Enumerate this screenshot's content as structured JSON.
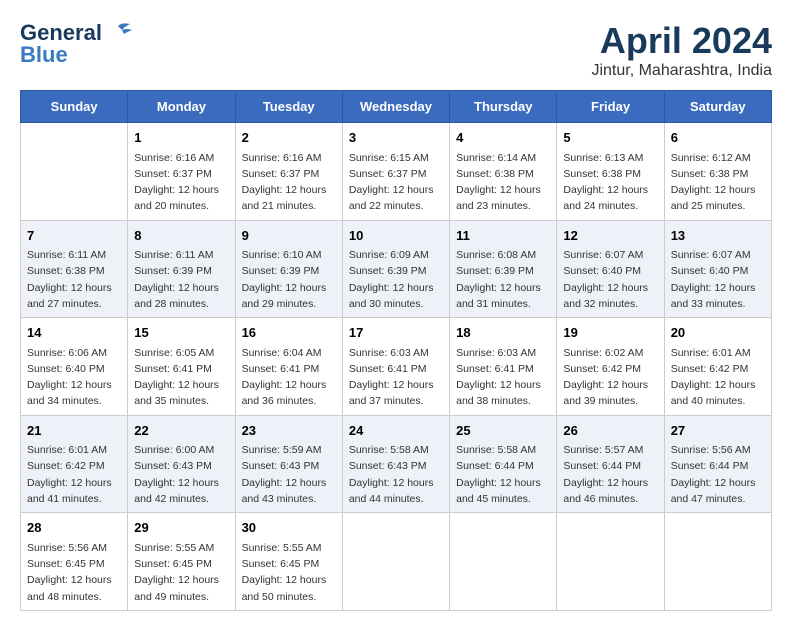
{
  "logo": {
    "line1": "General",
    "line2": "Blue"
  },
  "title": "April 2024",
  "subtitle": "Jintur, Maharashtra, India",
  "days_header": [
    "Sunday",
    "Monday",
    "Tuesday",
    "Wednesday",
    "Thursday",
    "Friday",
    "Saturday"
  ],
  "weeks": [
    [
      {
        "num": "",
        "detail": ""
      },
      {
        "num": "1",
        "detail": "Sunrise: 6:16 AM\nSunset: 6:37 PM\nDaylight: 12 hours\nand 20 minutes."
      },
      {
        "num": "2",
        "detail": "Sunrise: 6:16 AM\nSunset: 6:37 PM\nDaylight: 12 hours\nand 21 minutes."
      },
      {
        "num": "3",
        "detail": "Sunrise: 6:15 AM\nSunset: 6:37 PM\nDaylight: 12 hours\nand 22 minutes."
      },
      {
        "num": "4",
        "detail": "Sunrise: 6:14 AM\nSunset: 6:38 PM\nDaylight: 12 hours\nand 23 minutes."
      },
      {
        "num": "5",
        "detail": "Sunrise: 6:13 AM\nSunset: 6:38 PM\nDaylight: 12 hours\nand 24 minutes."
      },
      {
        "num": "6",
        "detail": "Sunrise: 6:12 AM\nSunset: 6:38 PM\nDaylight: 12 hours\nand 25 minutes."
      }
    ],
    [
      {
        "num": "7",
        "detail": "Sunrise: 6:11 AM\nSunset: 6:38 PM\nDaylight: 12 hours\nand 27 minutes."
      },
      {
        "num": "8",
        "detail": "Sunrise: 6:11 AM\nSunset: 6:39 PM\nDaylight: 12 hours\nand 28 minutes."
      },
      {
        "num": "9",
        "detail": "Sunrise: 6:10 AM\nSunset: 6:39 PM\nDaylight: 12 hours\nand 29 minutes."
      },
      {
        "num": "10",
        "detail": "Sunrise: 6:09 AM\nSunset: 6:39 PM\nDaylight: 12 hours\nand 30 minutes."
      },
      {
        "num": "11",
        "detail": "Sunrise: 6:08 AM\nSunset: 6:39 PM\nDaylight: 12 hours\nand 31 minutes."
      },
      {
        "num": "12",
        "detail": "Sunrise: 6:07 AM\nSunset: 6:40 PM\nDaylight: 12 hours\nand 32 minutes."
      },
      {
        "num": "13",
        "detail": "Sunrise: 6:07 AM\nSunset: 6:40 PM\nDaylight: 12 hours\nand 33 minutes."
      }
    ],
    [
      {
        "num": "14",
        "detail": "Sunrise: 6:06 AM\nSunset: 6:40 PM\nDaylight: 12 hours\nand 34 minutes."
      },
      {
        "num": "15",
        "detail": "Sunrise: 6:05 AM\nSunset: 6:41 PM\nDaylight: 12 hours\nand 35 minutes."
      },
      {
        "num": "16",
        "detail": "Sunrise: 6:04 AM\nSunset: 6:41 PM\nDaylight: 12 hours\nand 36 minutes."
      },
      {
        "num": "17",
        "detail": "Sunrise: 6:03 AM\nSunset: 6:41 PM\nDaylight: 12 hours\nand 37 minutes."
      },
      {
        "num": "18",
        "detail": "Sunrise: 6:03 AM\nSunset: 6:41 PM\nDaylight: 12 hours\nand 38 minutes."
      },
      {
        "num": "19",
        "detail": "Sunrise: 6:02 AM\nSunset: 6:42 PM\nDaylight: 12 hours\nand 39 minutes."
      },
      {
        "num": "20",
        "detail": "Sunrise: 6:01 AM\nSunset: 6:42 PM\nDaylight: 12 hours\nand 40 minutes."
      }
    ],
    [
      {
        "num": "21",
        "detail": "Sunrise: 6:01 AM\nSunset: 6:42 PM\nDaylight: 12 hours\nand 41 minutes."
      },
      {
        "num": "22",
        "detail": "Sunrise: 6:00 AM\nSunset: 6:43 PM\nDaylight: 12 hours\nand 42 minutes."
      },
      {
        "num": "23",
        "detail": "Sunrise: 5:59 AM\nSunset: 6:43 PM\nDaylight: 12 hours\nand 43 minutes."
      },
      {
        "num": "24",
        "detail": "Sunrise: 5:58 AM\nSunset: 6:43 PM\nDaylight: 12 hours\nand 44 minutes."
      },
      {
        "num": "25",
        "detail": "Sunrise: 5:58 AM\nSunset: 6:44 PM\nDaylight: 12 hours\nand 45 minutes."
      },
      {
        "num": "26",
        "detail": "Sunrise: 5:57 AM\nSunset: 6:44 PM\nDaylight: 12 hours\nand 46 minutes."
      },
      {
        "num": "27",
        "detail": "Sunrise: 5:56 AM\nSunset: 6:44 PM\nDaylight: 12 hours\nand 47 minutes."
      }
    ],
    [
      {
        "num": "28",
        "detail": "Sunrise: 5:56 AM\nSunset: 6:45 PM\nDaylight: 12 hours\nand 48 minutes."
      },
      {
        "num": "29",
        "detail": "Sunrise: 5:55 AM\nSunset: 6:45 PM\nDaylight: 12 hours\nand 49 minutes."
      },
      {
        "num": "30",
        "detail": "Sunrise: 5:55 AM\nSunset: 6:45 PM\nDaylight: 12 hours\nand 50 minutes."
      },
      {
        "num": "",
        "detail": ""
      },
      {
        "num": "",
        "detail": ""
      },
      {
        "num": "",
        "detail": ""
      },
      {
        "num": "",
        "detail": ""
      }
    ]
  ]
}
